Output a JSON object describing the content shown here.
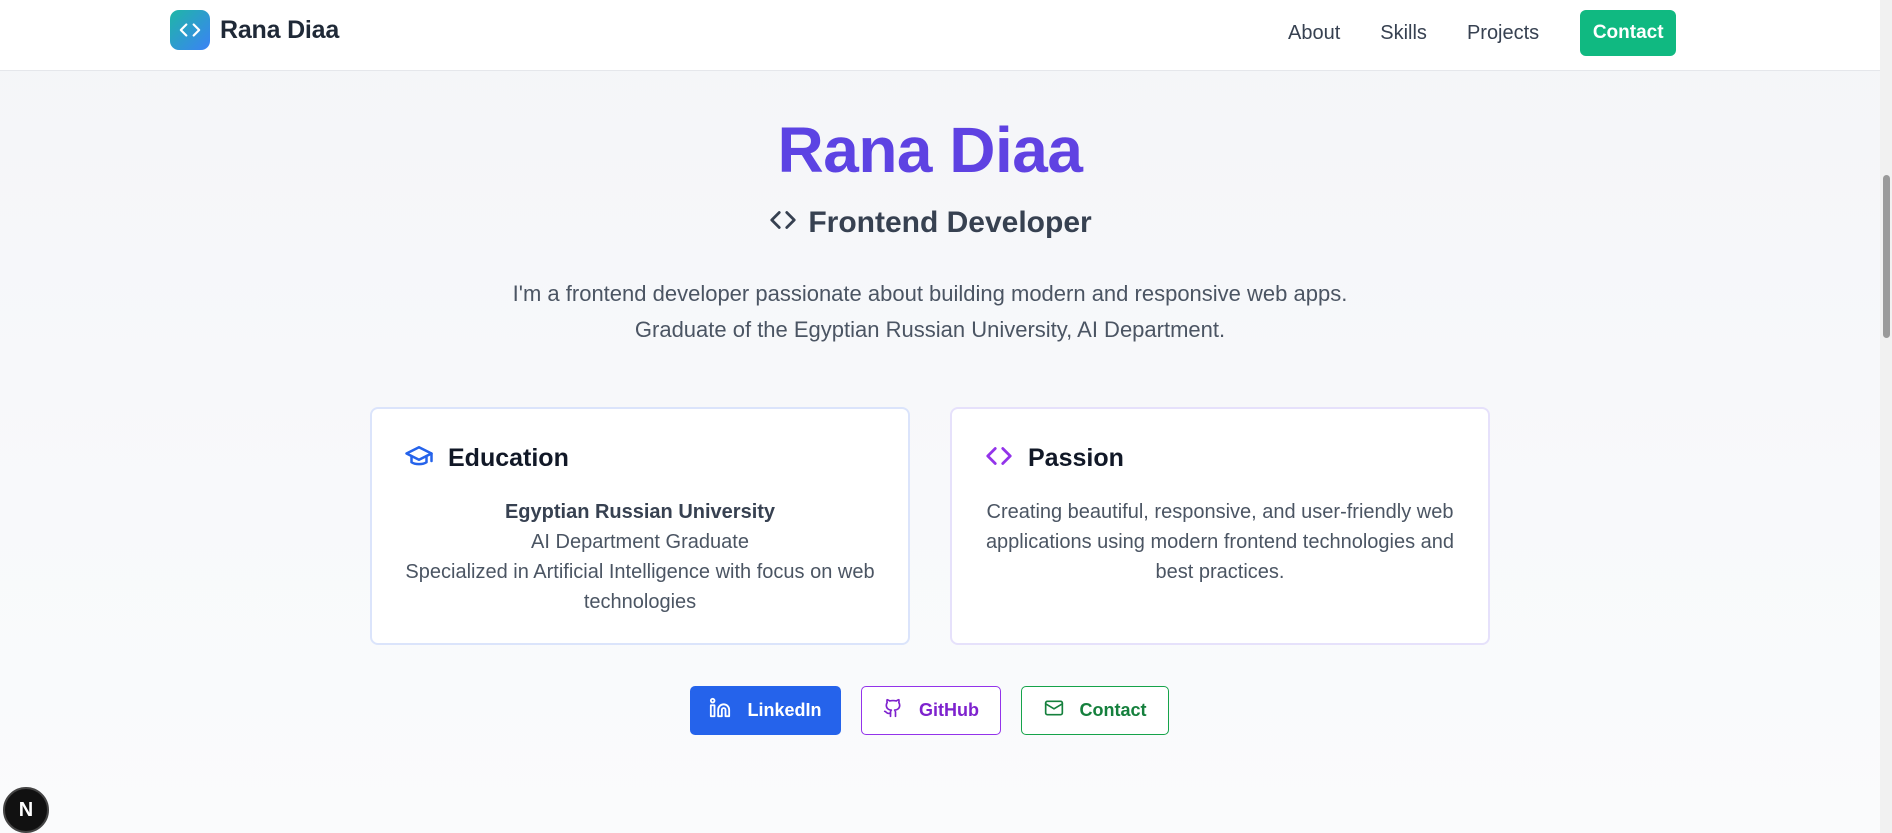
{
  "header": {
    "brand_name": "Rana Diaa",
    "nav": {
      "about": "About",
      "skills": "Skills",
      "projects": "Projects",
      "contact": "Contact"
    }
  },
  "hero": {
    "name": "Rana Diaa",
    "role": "Frontend Developer",
    "bio": "I'm a frontend developer passionate about building modern and responsive web apps. Graduate of the Egyptian Russian University, AI Department."
  },
  "cards": {
    "education": {
      "title": "Education",
      "university": "Egyptian Russian University",
      "degree": "AI Department Graduate",
      "detail": "Specialized in Artificial Intelligence with focus on web technologies"
    },
    "passion": {
      "title": "Passion",
      "text": "Creating beautiful, responsive, and user-friendly web applications using modern frontend technologies and best practices."
    }
  },
  "buttons": {
    "linkedin": "LinkedIn",
    "github": "GitHub",
    "contact": "Contact"
  },
  "badge": "N",
  "colors": {
    "accent_purple": "#5b45e0",
    "contact_green": "#10b981",
    "linkedin_blue": "#2563eb",
    "github_purple": "#9333ea",
    "contact_outline_green": "#16a34a"
  }
}
